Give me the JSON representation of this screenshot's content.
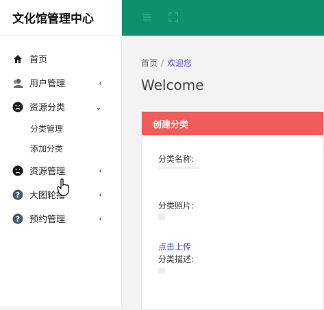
{
  "app": {
    "title": "文化馆管理中心"
  },
  "sidebar": {
    "items": [
      {
        "label": "首页",
        "icon": "home-icon"
      },
      {
        "label": "用户管理",
        "icon": "users-icon",
        "arrow": "‹"
      },
      {
        "label": "资源分类",
        "icon": "frown-face-icon",
        "arrow": "⌄"
      },
      {
        "label": "资源管理",
        "icon": "frown-face-icon",
        "arrow": "‹"
      },
      {
        "label": "大图轮播",
        "icon": "question-circle-icon",
        "arrow": "‹"
      },
      {
        "label": "预约管理",
        "icon": "question-circle-icon",
        "arrow": "‹"
      }
    ],
    "subitems": [
      {
        "label": "分类管理"
      },
      {
        "label": "添加分类"
      }
    ]
  },
  "topbar": {
    "color": "#0f8f6c",
    "icons": [
      "menu-icon",
      "fullscreen-icon"
    ]
  },
  "breadcrumb": {
    "home": "首页",
    "separator": "/",
    "current": "欢迎您"
  },
  "page": {
    "welcome": "Welcome"
  },
  "card": {
    "title": "创建分类",
    "header_color": "#f05b5b",
    "fields": {
      "name_label": "分类名称:",
      "photo_label": "分类照片:",
      "upload_link": "点击上传",
      "desc_label": "分类描述:"
    }
  }
}
